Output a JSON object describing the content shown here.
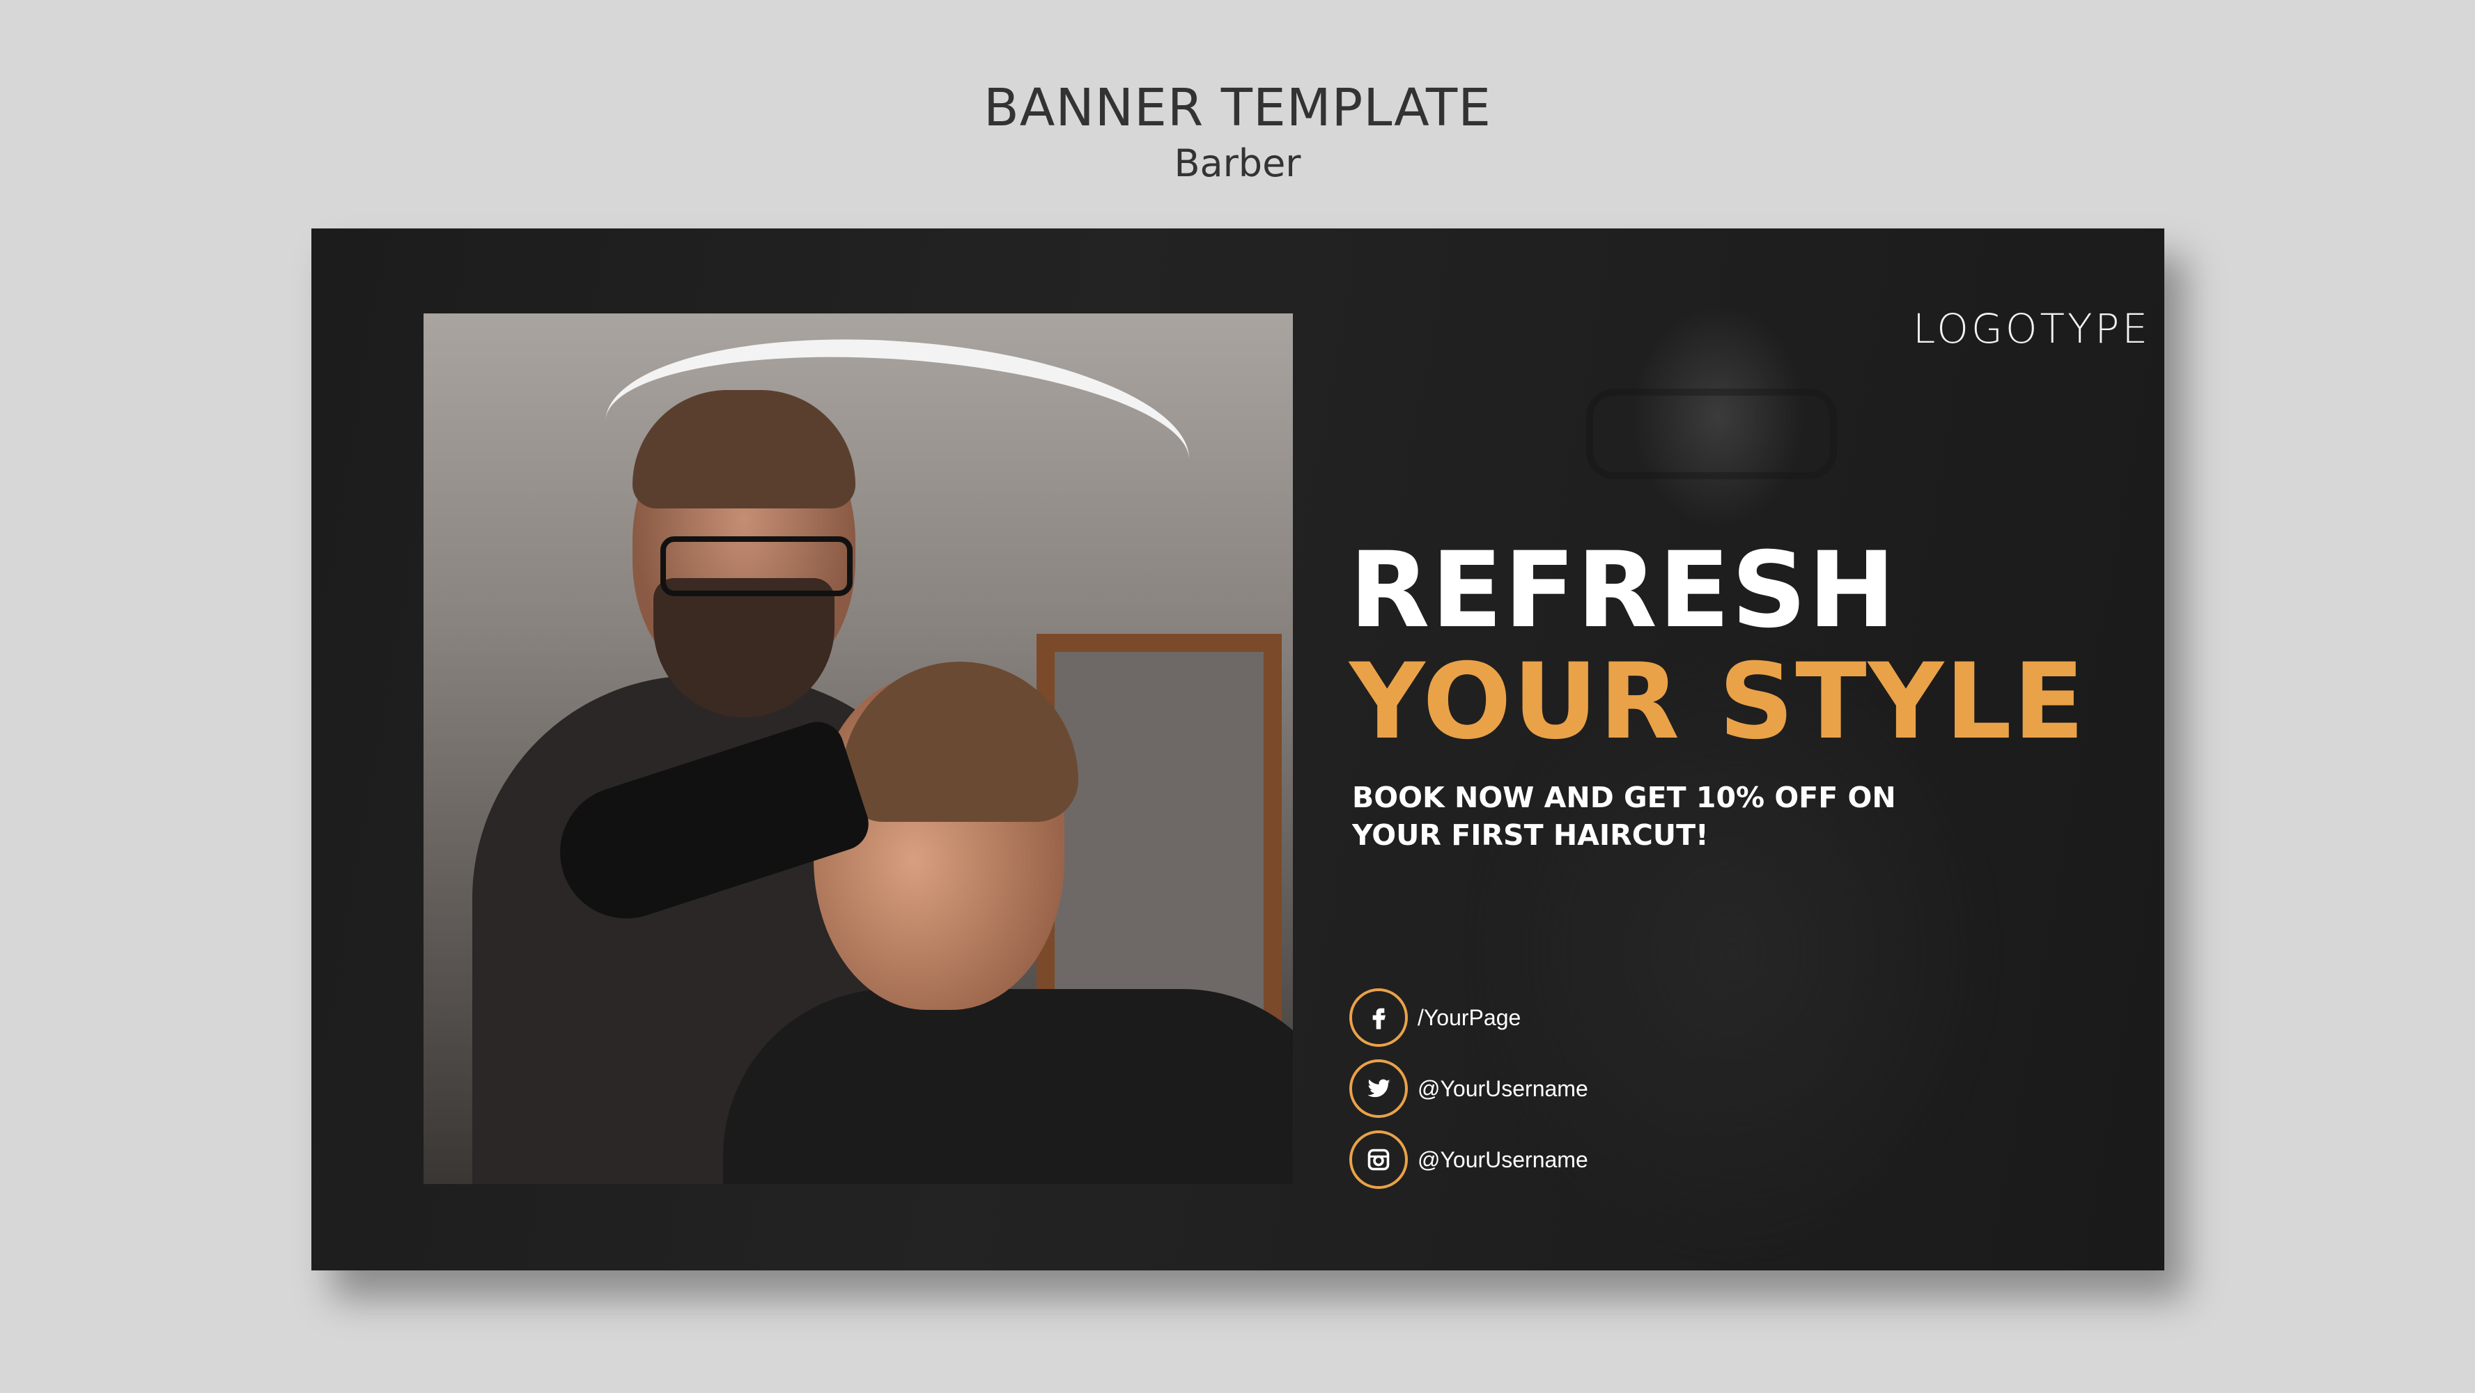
{
  "heading": {
    "title": "BANNER TEMPLATE",
    "subtitle": "Barber"
  },
  "banner": {
    "logotype": "LOGOTYPE",
    "headline_line1": "REFRESH",
    "headline_line2": "YOUR STYLE",
    "offer_line1": "BOOK NOW AND GET 10% OFF ON",
    "offer_line2": "YOUR FIRST HAIRCUT!",
    "accent_color": "#eaa248",
    "socials": [
      {
        "icon": "facebook-icon",
        "text": "/YourPage"
      },
      {
        "icon": "twitter-icon",
        "text": "@YourUsername"
      },
      {
        "icon": "instagram-icon",
        "text": "@YourUsername"
      }
    ]
  }
}
